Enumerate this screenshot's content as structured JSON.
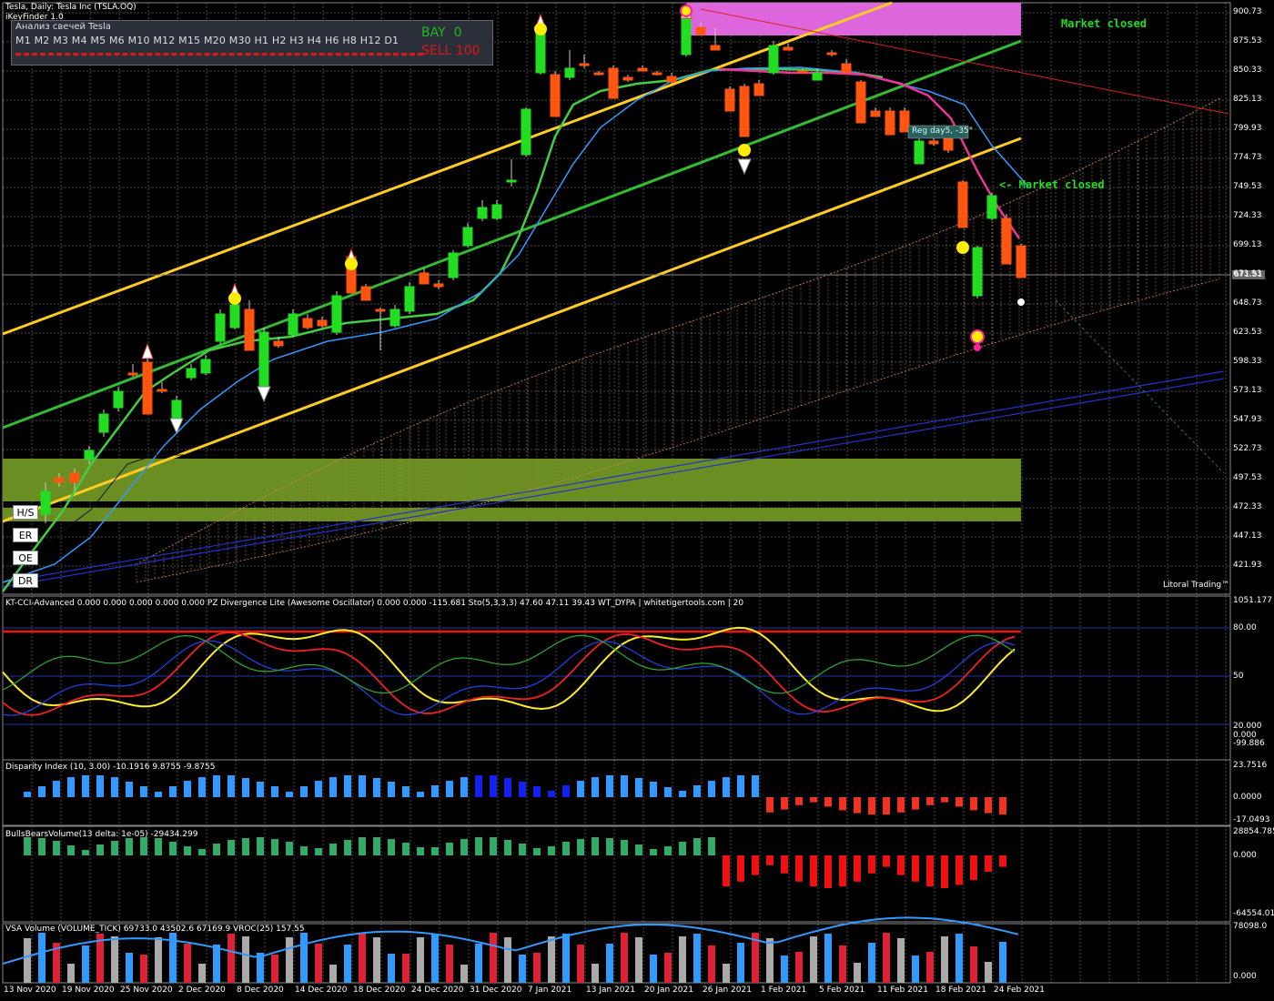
{
  "header": {
    "symbol_line": "Tesla, Daily: Tesla Inc (TSLA.OQ)",
    "indicator_line": "iKeyFinder 1.0"
  },
  "timeframe_panel": {
    "title": "Анализ свечей Tesla",
    "timeframes": [
      "M1",
      "M2",
      "M3",
      "M4",
      "M5",
      "M6",
      "M10",
      "M12",
      "M15",
      "M20",
      "M30",
      "H1",
      "H2",
      "H3",
      "H4",
      "H6",
      "H8",
      "H12",
      "D1"
    ],
    "bay_label": "BAY",
    "bay_value": "0",
    "sell_label": "SELL",
    "sell_value": "100"
  },
  "labels": {
    "market_closed_top": "Market closed",
    "market_closed_mid": "<- Market closed",
    "reg_label": "Reg day5, -35°",
    "watermark": "Litoral Trading™",
    "current_price": "671.51"
  },
  "side_buttons": [
    "H/S",
    "ER",
    "OE",
    "DR"
  ],
  "price_axis": [
    "900.73",
    "875.53",
    "850.33",
    "825.13",
    "799.93",
    "774.73",
    "749.53",
    "724.33",
    "699.13",
    "673.93",
    "648.73",
    "623.53",
    "598.33",
    "573.13",
    "547.93",
    "522.73",
    "497.53",
    "472.33",
    "447.13",
    "421.93"
  ],
  "panels": {
    "cci_title": "KT-CCI-Advanced 0.000 0.000 0.000 0.000 0.000 PZ Divergence Lite (Awesome Oscillator) 0.000 0.000 -115.681 Sto(5,3,3,3) 47.60 47.11 39.43 WT_DYPA | whitetigertools.com | 20",
    "cci_scale": [
      "1051.177",
      "80.00",
      "50",
      "20.000",
      "0.000",
      "-99.886"
    ],
    "disparity_title": "Disparity Index (10, 3.00) -10.1916 9.8755 -9.8755",
    "disparity_scale": [
      "23.7516",
      "0.0000",
      "-17.0493"
    ],
    "bbv_title": "BullsBearsVolume(13  delta: 1e-05) -29434.299",
    "bbv_scale": [
      "28854.785",
      "0.000",
      "-64554.01"
    ],
    "vsa_title": "VSA Volume (VOLUME_TICK) 69733.0 43502.6 67169.9 VROC(25) 157.55",
    "vsa_scale": [
      "78098.0",
      "0.000"
    ]
  },
  "date_axis": [
    "13 Nov 2020",
    "19 Nov 2020",
    "25 Nov 2020",
    "2 Dec 2020",
    "8 Dec 2020",
    "14 Dec 2020",
    "18 Dec 2020",
    "24 Dec 2020",
    "31 Dec 2020",
    "7 Jan 2021",
    "13 Jan 2021",
    "20 Jan 2021",
    "26 Jan 2021",
    "1 Feb 2021",
    "5 Feb 2021",
    "11 Feb 2021",
    "18 Feb 2021",
    "24 Feb 2021"
  ],
  "colors": {
    "background": "#000000",
    "grid": "#5a5a5a",
    "bull_candle": "#22dd22",
    "bear_candle": "#ff5511",
    "channel": "#ffcc22",
    "trendline": "#33bb33",
    "ma_blue": "#3399ff",
    "zone": "#6b8e23",
    "resistance_zone": "#dd66dd"
  }
}
